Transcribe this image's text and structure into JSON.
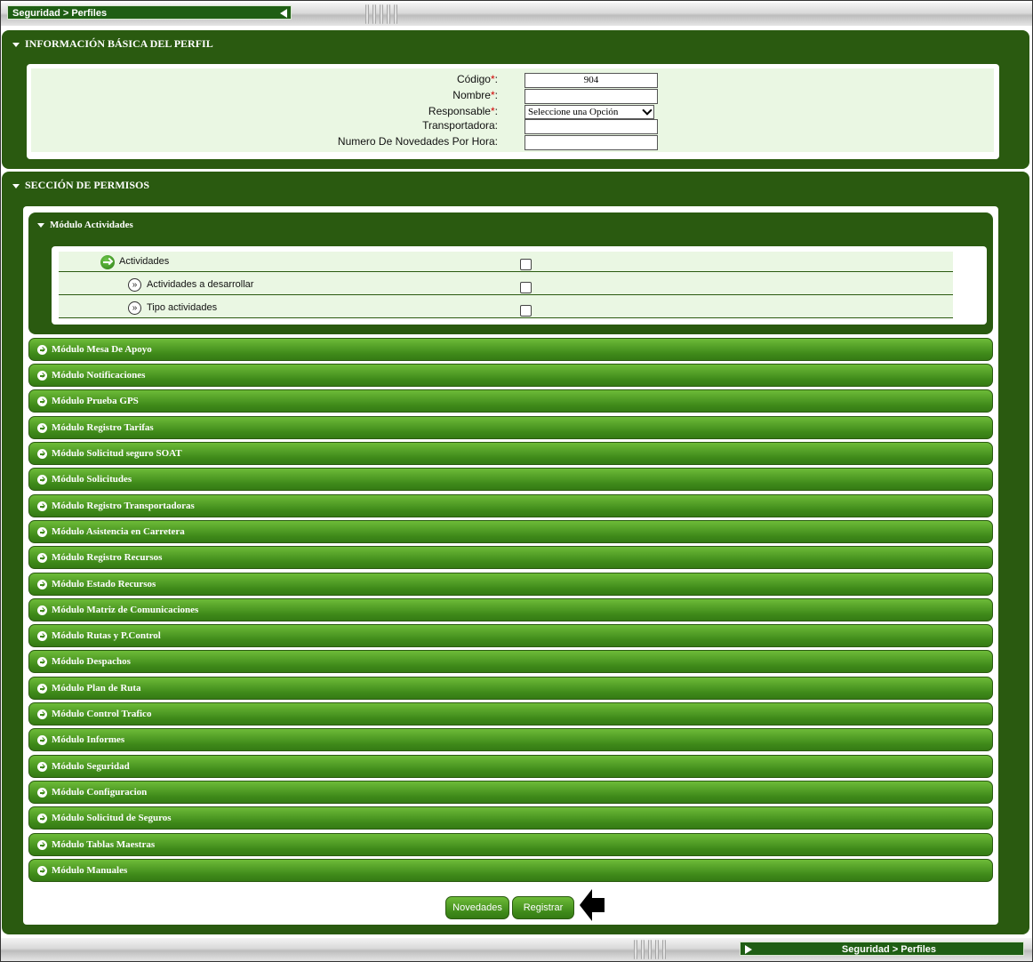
{
  "breadcrumb": {
    "top": "Seguridad > Perfiles",
    "bottom": "Seguridad > Perfiles"
  },
  "section_basic": {
    "title": "INFORMACIÓN BÁSICA DEL PERFIL",
    "fields": {
      "codigo_label": "Código",
      "codigo_value": "904",
      "nombre_label": "Nombre",
      "responsable_label": "Responsable",
      "responsable_value": "Seleccione una Opción",
      "transportadora_label": "Transportadora:",
      "novedades_label": "Numero De Novedades Por Hora:",
      "required_mark": "*",
      "colon": ":"
    }
  },
  "section_permissions": {
    "title": "SECCIÓN DE PERMISOS",
    "open_module": {
      "title": "Módulo Actividades",
      "rows": [
        {
          "label": "Actividades",
          "checked": false
        },
        {
          "label": "Actividades a desarrollar",
          "checked": false
        },
        {
          "label": "Tipo actividades",
          "checked": false
        }
      ]
    },
    "modules": [
      "Módulo Mesa De Apoyo",
      "Módulo Notificaciones",
      "Módulo Prueba GPS",
      "Módulo Registro Tarifas",
      "Módulo Solicitud seguro SOAT",
      "Módulo Solicitudes",
      "Módulo Registro Transportadoras",
      "Módulo Asistencia en Carretera",
      "Módulo Registro Recursos",
      "Módulo Estado Recursos",
      "Módulo Matriz de Comunicaciones",
      "Módulo Rutas y P.Control",
      "Módulo Despachos",
      "Módulo Plan de Ruta",
      "Módulo Control Trafico",
      "Módulo Informes",
      "Módulo Seguridad",
      "Módulo Configuracion",
      "Módulo Solicitud de Seguros",
      "Módulo Tablas Maestras",
      "Módulo Manuales"
    ]
  },
  "buttons": {
    "novedades": "Novedades",
    "registrar": "Registrar"
  },
  "colors": {
    "dark_green": "#2a5a10",
    "light_green_bg": "#eaf7e3",
    "button_green": "#3f8a1a",
    "required": "#d00000"
  }
}
